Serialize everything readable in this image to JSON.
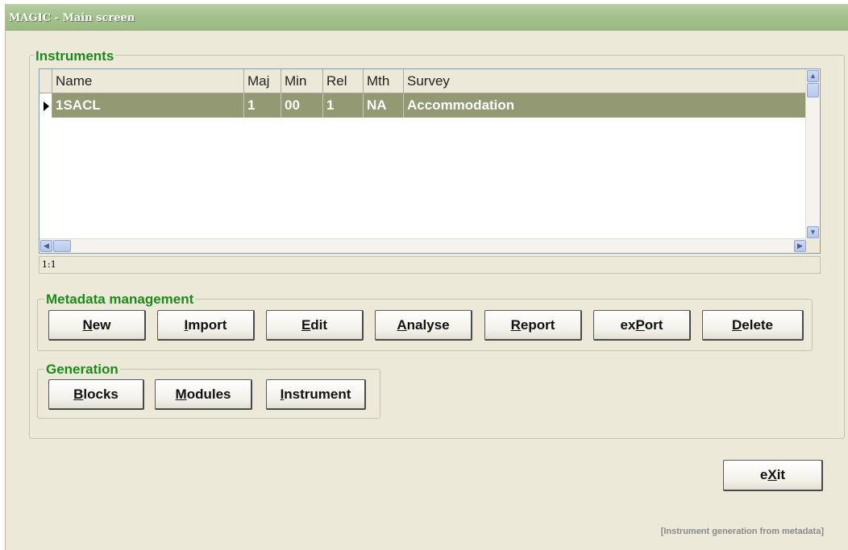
{
  "window": {
    "title": "MAGIC - Main screen"
  },
  "instruments": {
    "legend": "Instruments",
    "columns": [
      "Name",
      "Maj",
      "Min",
      "Rel",
      "Mth",
      "Survey"
    ],
    "rows": [
      {
        "name": "1SACL",
        "maj": "1",
        "min": "00",
        "rel": "1",
        "mth": "NA",
        "survey": "Accommodation"
      }
    ],
    "status": "1:1"
  },
  "metadata_management": {
    "legend": "Metadata management",
    "buttons": [
      {
        "pre": "",
        "key": "N",
        "post": "ew"
      },
      {
        "pre": "",
        "key": "I",
        "post": "mport"
      },
      {
        "pre": "",
        "key": "E",
        "post": "dit"
      },
      {
        "pre": "",
        "key": "A",
        "post": "nalyse"
      },
      {
        "pre": "",
        "key": "R",
        "post": "eport"
      },
      {
        "pre": "ex",
        "key": "P",
        "post": "ort"
      },
      {
        "pre": "",
        "key": "D",
        "post": "elete"
      }
    ]
  },
  "generation": {
    "legend": "Generation",
    "buttons": [
      {
        "pre": "",
        "key": "B",
        "post": "locks"
      },
      {
        "pre": "",
        "key": "M",
        "post": "odules"
      },
      {
        "pre": "",
        "key": "I",
        "post": "nstrument"
      }
    ]
  },
  "exit_button": {
    "pre": "e",
    "key": "X",
    "post": "it"
  },
  "footer": {
    "note": "[Instrument generation from metadata]"
  },
  "icons": [
    "scroll-up-icon",
    "scroll-down-icon",
    "scroll-left-icon",
    "scroll-right-icon",
    "row-pointer-icon"
  ]
}
